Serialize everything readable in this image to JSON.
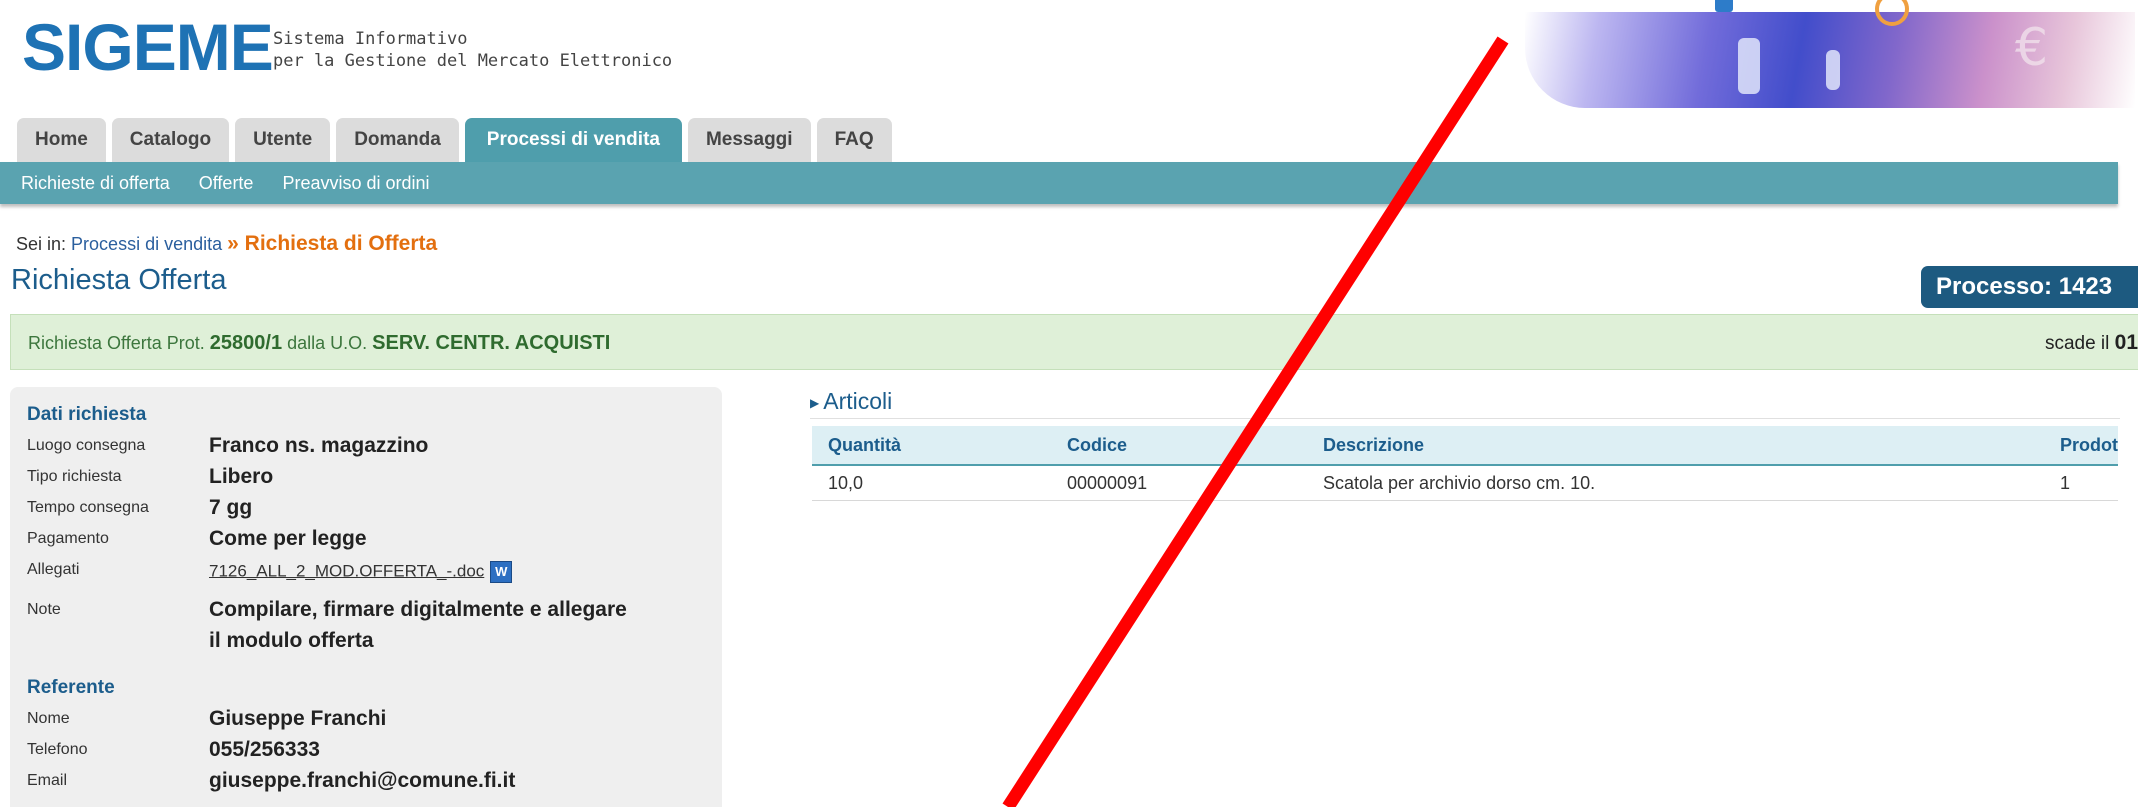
{
  "header": {
    "logo": "SIGEME",
    "tagline_line1": "Sistema Informativo",
    "tagline_line2": "per la Gestione del Mercato Elettronico"
  },
  "tabs": [
    {
      "label": "Home"
    },
    {
      "label": "Catalogo"
    },
    {
      "label": "Utente"
    },
    {
      "label": "Domanda"
    },
    {
      "label": "Processi di vendita",
      "active": true
    },
    {
      "label": "Messaggi"
    },
    {
      "label": "FAQ"
    }
  ],
  "subnav": [
    "Richieste di offerta",
    "Offerte",
    "Preavviso di ordini"
  ],
  "breadcrumb": {
    "prefix": "Sei in:",
    "link": "Processi di vendita",
    "current": "» Richiesta di Offerta"
  },
  "page_title": "Richiesta Offerta",
  "process_badge": "Processo: 1423",
  "infobar": {
    "t1": "Richiesta Offerta Prot.",
    "prot": "25800/1",
    "t2": "dalla U.O.",
    "uo": "SERV. CENTR. ACQUISTI",
    "expires_label": "scade il",
    "expires_value": "01"
  },
  "dati": {
    "title": "Dati richiesta",
    "luogo_label": "Luogo consegna",
    "luogo": "Franco ns. magazzino",
    "tipo_label": "Tipo richiesta",
    "tipo": "Libero",
    "tempo_label": "Tempo consegna",
    "tempo": "7 gg",
    "pagamento_label": "Pagamento",
    "pagamento": "Come per legge",
    "allegati_label": "Allegati",
    "allegato": "7126_ALL_2_MOD.OFFERTA_-.doc",
    "note_label": "Note",
    "note_line1": "Compilare, firmare digitalmente e allegare",
    "note_line2": "il modulo offerta"
  },
  "referente": {
    "title": "Referente",
    "nome_label": "Nome",
    "nome": "Giuseppe Franchi",
    "telefono_label": "Telefono",
    "telefono": "055/256333",
    "email_label": "Email",
    "email": "giuseppe.franchi@comune.fi.it"
  },
  "articoli": {
    "title": "Articoli",
    "columns": [
      "Quantità",
      "Codice",
      "Descrizione",
      "Prodot"
    ],
    "rows": [
      [
        "10,0",
        "00000091",
        "Scatola per archivio dorso cm. 10.",
        "1"
      ]
    ]
  },
  "colors": {
    "tab_active": "#4f9eac",
    "annotation": "#ff0000",
    "brand": "#1e72b4"
  }
}
